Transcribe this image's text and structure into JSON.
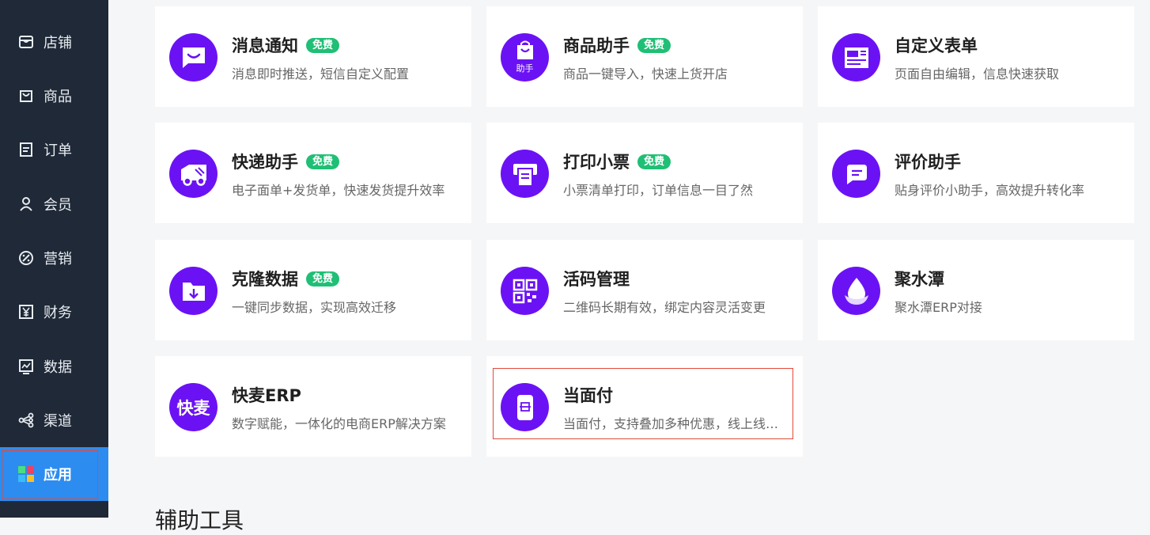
{
  "sidebar": {
    "items": [
      {
        "label": "店铺",
        "icon": "store-icon"
      },
      {
        "label": "商品",
        "icon": "bag-icon"
      },
      {
        "label": "订单",
        "icon": "order-icon"
      },
      {
        "label": "会员",
        "icon": "user-icon"
      },
      {
        "label": "营销",
        "icon": "percent-icon"
      },
      {
        "label": "财务",
        "icon": "yen-icon"
      },
      {
        "label": "数据",
        "icon": "chart-icon"
      },
      {
        "label": "渠道",
        "icon": "share-icon"
      },
      {
        "label": "应用",
        "icon": "apps-icon",
        "active": true
      }
    ]
  },
  "apps": [
    {
      "title": "消息通知",
      "badge": "免费",
      "desc": "消息即时推送，短信自定义配置",
      "icon": "message-icon"
    },
    {
      "title": "商品助手",
      "badge": "免费",
      "desc": "商品一键导入，快速上货开店",
      "icon": "product-helper-icon",
      "icon_text": "助手"
    },
    {
      "title": "自定义表单",
      "badge": "",
      "desc": "页面自由编辑，信息快速获取",
      "icon": "form-icon"
    },
    {
      "title": "快递助手",
      "badge": "免费",
      "desc": "电子面单+发货单，快速发货提升效率",
      "icon": "truck-icon"
    },
    {
      "title": "打印小票",
      "badge": "免费",
      "desc": "小票清单打印，订单信息一目了然",
      "icon": "printer-icon"
    },
    {
      "title": "评价助手",
      "badge": "",
      "desc": "贴身评价小助手，高效提升转化率",
      "icon": "review-icon"
    },
    {
      "title": "克隆数据",
      "badge": "免费",
      "desc": "一键同步数据，实现高效迁移",
      "icon": "folder-download-icon"
    },
    {
      "title": "活码管理",
      "badge": "",
      "desc": "二维码长期有效，绑定内容灵活变更",
      "icon": "qrcode-icon"
    },
    {
      "title": "聚水潭",
      "badge": "",
      "desc": "聚水潭ERP对接",
      "icon": "water-drop-icon"
    },
    {
      "title": "快麦ERP",
      "badge": "",
      "desc": "数字赋能，一体化的电商ERP解决方案",
      "icon": "kuaimai-logo-icon",
      "icon_text": "快麦"
    },
    {
      "title": "当面付",
      "badge": "",
      "desc": "当面付，支持叠加多种优惠，线上线下一体化收款",
      "icon": "phone-scan-icon"
    }
  ],
  "section": {
    "title": "辅助工具"
  },
  "colors": {
    "sidebar_bg": "#1f2937",
    "accent": "#2d8cf0",
    "app_icon": "#6b12f5",
    "badge": "#1fbf75"
  }
}
